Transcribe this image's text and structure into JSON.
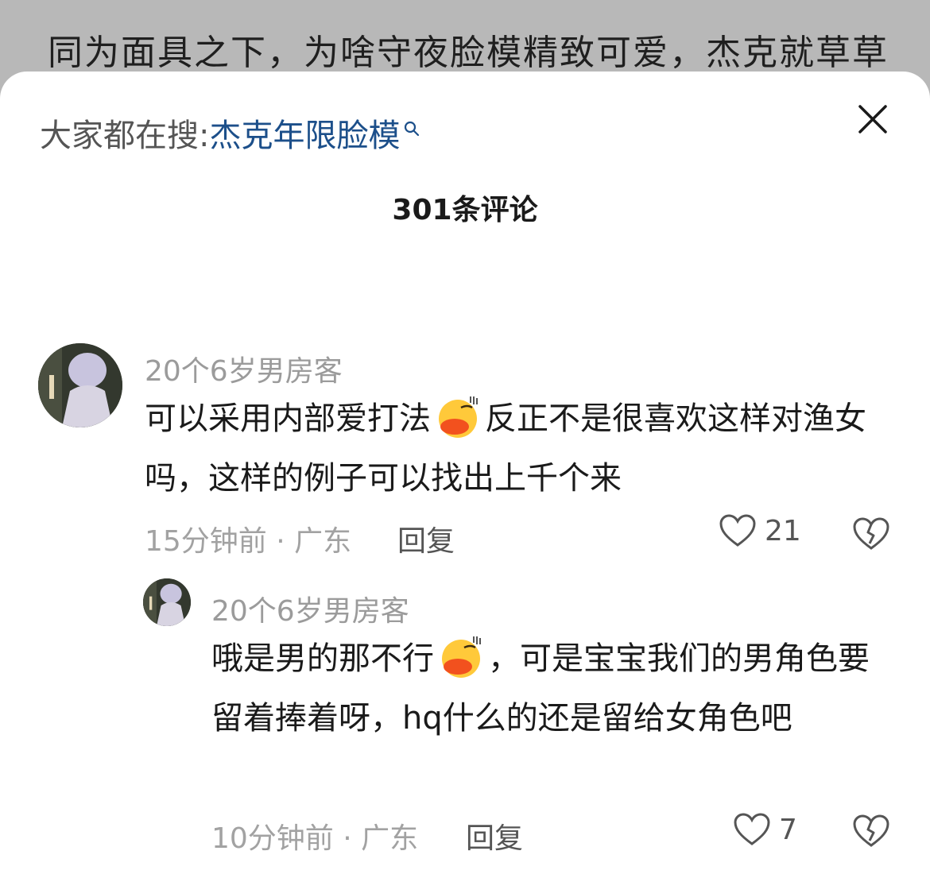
{
  "post": {
    "title": "同为面具之下，为啥守夜脸模精致可爱，杰克就草草"
  },
  "search": {
    "prefix": "大家都在搜:",
    "term": "杰克年限脸模"
  },
  "comments_header": {
    "count_label": "301条评论"
  },
  "comments": [
    {
      "username": "20个6岁男房客",
      "text_before_emoji": "可以采用内部爱打法",
      "emoji": "duck-emoji",
      "text_after_emoji": "反正不是很喜欢这样对渔女吗，这样的例子可以找出上千个来",
      "time": "15分钟前",
      "location": "广东",
      "meta_label": "15分钟前 · 广东",
      "reply_label": "回复",
      "likes": "21"
    },
    {
      "username": "20个6岁男房客",
      "text_before_emoji": "哦是男的那不行",
      "emoji": "duck-emoji",
      "text_after_emoji": "，可是宝宝我们的男角色要留着捧着呀，hq什么的还是留给女角色吧",
      "time": "10分钟前",
      "location": "广东",
      "meta_label": "10分钟前 · 广东",
      "reply_label": "回复",
      "likes": "7"
    }
  ],
  "colors": {
    "search_term": "#1c4f8a",
    "muted_text": "#9b9b9b",
    "body_text": "#1a1a1a",
    "backdrop": "#b8b8b8"
  }
}
